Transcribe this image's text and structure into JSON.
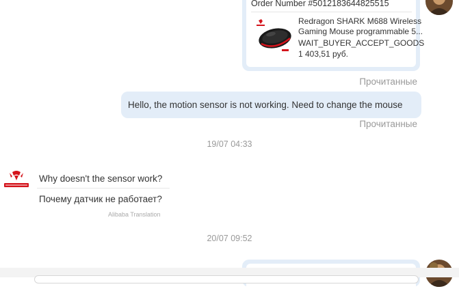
{
  "order_card": {
    "order_number": "Order Number #5012183644825515",
    "product": {
      "title_line1": "Redragon SHARK M688 Wireless",
      "title_line2": "Gaming Mouse programmable 5...",
      "status": "WAIT_BUYER_ACCEPT_GOODS",
      "price": "1 403,51 руб."
    }
  },
  "read_status_1": "Прочитанные",
  "outgoing_message": {
    "text": "Hello, the motion sensor is not working.  Need to change the mouse",
    "read_status": "Прочитанные"
  },
  "timestamp_1": "19/07 04:33",
  "seller_message": {
    "original": "Why doesn't the sensor work?",
    "translation": "Почему датчик не работает?",
    "translation_credit": "Alibaba Translation"
  },
  "timestamp_2": "20/07 09:52",
  "icons": {
    "seller_logo": "redragon-logo",
    "buyer_avatar": "user-avatar",
    "product_image": "gaming-mouse-thumbnail"
  },
  "colors": {
    "bubble_bg": "#e3edf8",
    "muted_text": "#999999",
    "brand_red": "#d4141c"
  }
}
